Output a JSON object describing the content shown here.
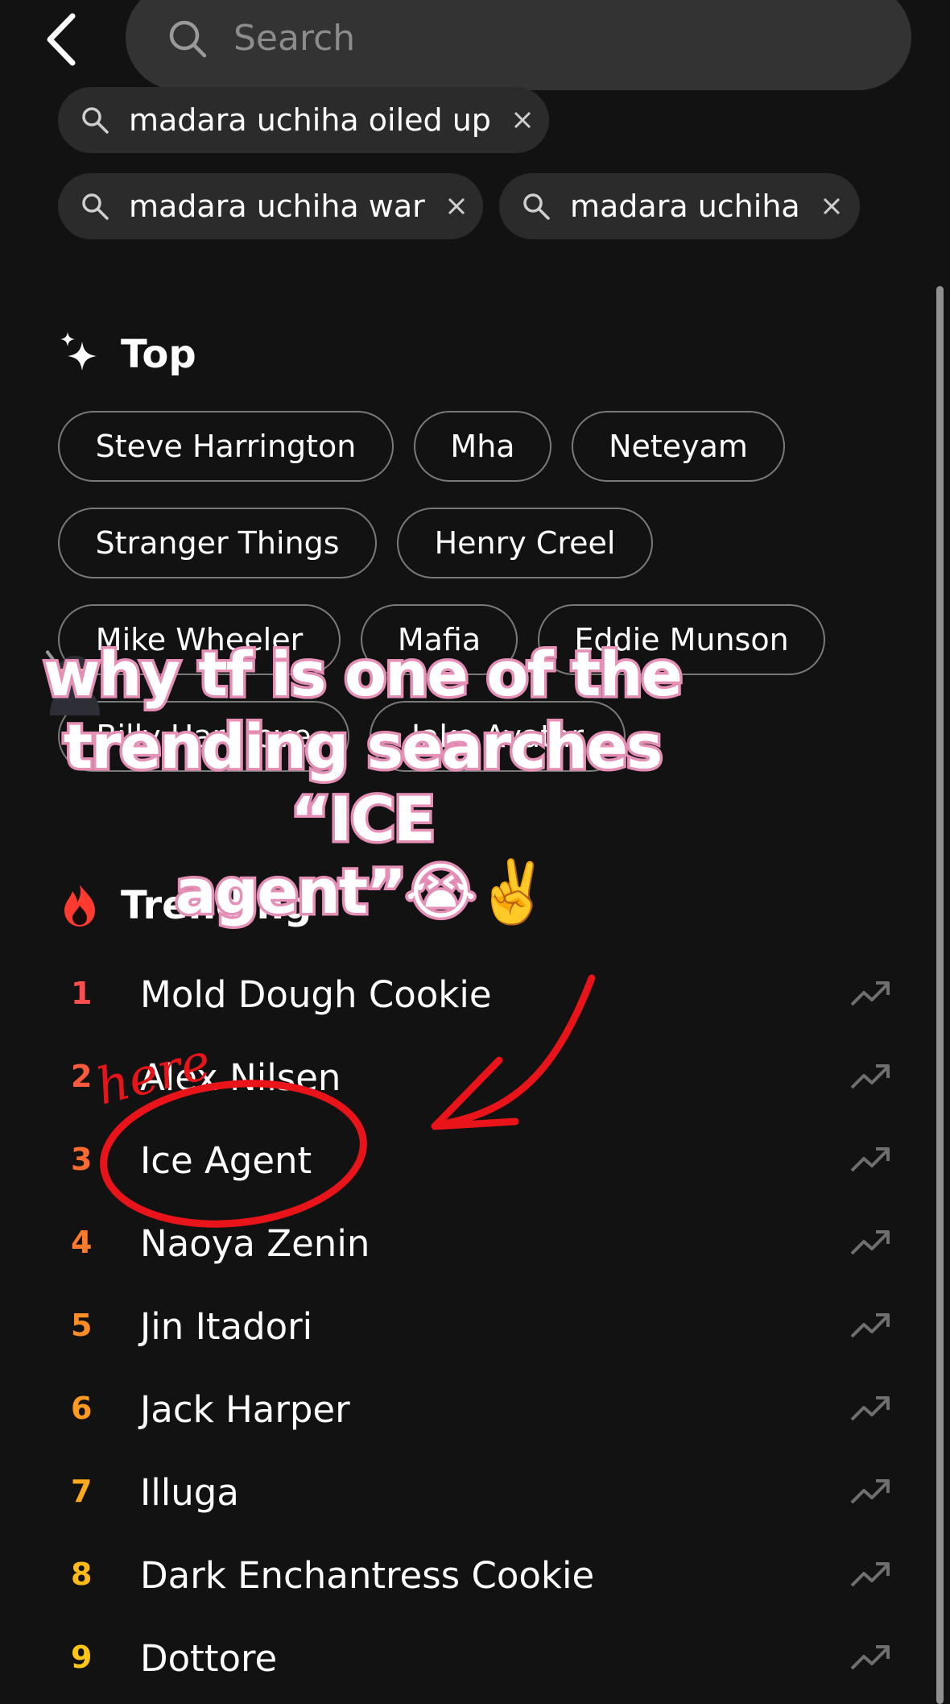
{
  "header": {
    "search_placeholder": "Search"
  },
  "history": [
    {
      "label": "madara uchiha oiled up"
    },
    {
      "label": "madara uchiha war"
    },
    {
      "label": "madara uchiha"
    }
  ],
  "top": {
    "title": "Top",
    "chips": [
      "Steve Harrington",
      "Mha",
      "Neteyam",
      "Stranger Things",
      "Henry Creel",
      "Mike Wheeler",
      "Mafia",
      "Eddie Munson",
      "Billy Hargrove",
      "Jake Avatar"
    ]
  },
  "trending": {
    "title": "Trending",
    "items": [
      {
        "rank": "1",
        "name": "Mold Dough Cookie",
        "rank_color": "#ff4d4d"
      },
      {
        "rank": "2",
        "name": "Alex Nilsen",
        "rank_color": "#ff5a3c"
      },
      {
        "rank": "3",
        "name": "Ice Agent",
        "rank_color": "#ff6a30"
      },
      {
        "rank": "4",
        "name": "Naoya Zenin",
        "rank_color": "#ff7a2a"
      },
      {
        "rank": "5",
        "name": "Jin Itadori",
        "rank_color": "#ff8c24"
      },
      {
        "rank": "6",
        "name": "Jack Harper",
        "rank_color": "#ff9a20"
      },
      {
        "rank": "7",
        "name": "Illuga",
        "rank_color": "#ffaa1c"
      },
      {
        "rank": "8",
        "name": "Dark Enchantress Cookie",
        "rank_color": "#ffba18"
      },
      {
        "rank": "9",
        "name": "Dottore",
        "rank_color": "#ffc614"
      }
    ]
  },
  "overlay": {
    "caption_line1": "why tf is one of the",
    "caption_line2": "trending searches “ICE",
    "caption_line3": "agent”😭✌️",
    "handwritten": "here",
    "ink_color": "#e8141a"
  }
}
